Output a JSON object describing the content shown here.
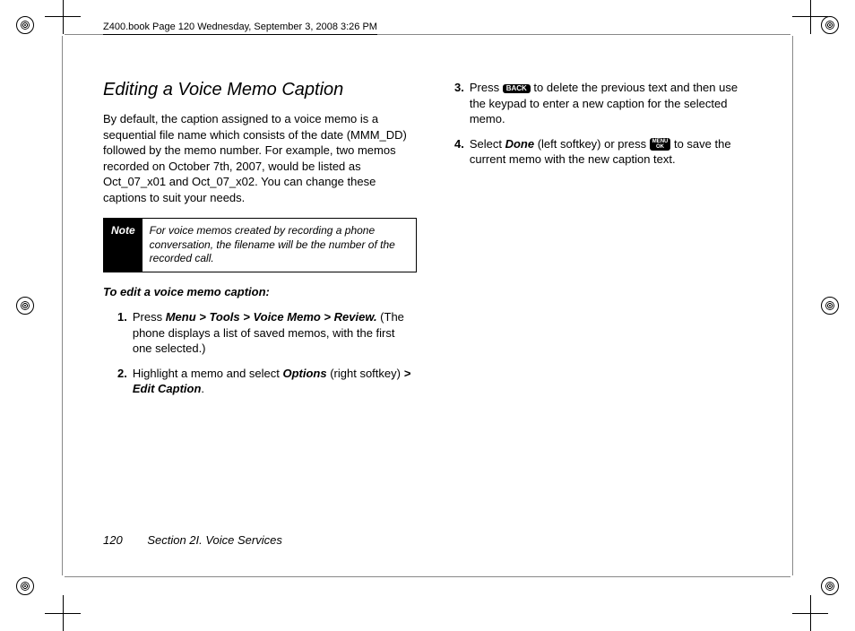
{
  "header": "Z400.book  Page 120  Wednesday, September 3, 2008  3:26 PM",
  "left": {
    "title": "Editing a Voice Memo Caption",
    "intro": "By default, the caption assigned to a voice memo is a sequential file name which consists of the date (MMM_DD) followed by the memo number. For example, two memos recorded on October 7th, 2007, would be listed as Oct_07_x01 and Oct_07_x02. You can change these captions to suit your needs.",
    "note_label": "Note",
    "note_text": "For voice memos created by recording a phone conversation, the filename will be the number of the recorded call.",
    "subheading": "To edit a voice memo caption:",
    "steps": [
      {
        "num": "1.",
        "pre": "Press ",
        "path": "Menu > Tools > Voice Memo > Review.",
        "post": " (The phone displays a list of saved memos, with the first one selected.)"
      },
      {
        "num": "2.",
        "pre": "Highlight a memo and select ",
        "opt": "Options",
        "mid": " (right softkey) ",
        "path": "> Edit Caption",
        "post": "."
      }
    ]
  },
  "right": {
    "steps": [
      {
        "num": "3.",
        "pre": "Press ",
        "key": "BACK",
        "post": " to delete the previous text and then use the keypad to enter a new caption for the selected memo."
      },
      {
        "num": "4.",
        "pre": "Select ",
        "done": "Done",
        "mid": " (left softkey) or press ",
        "key1": "MENU",
        "key2": "OK",
        "post": " to save the current memo with the new caption text."
      }
    ]
  },
  "footer": {
    "page": "120",
    "section": "Section 2I. Voice Services"
  }
}
